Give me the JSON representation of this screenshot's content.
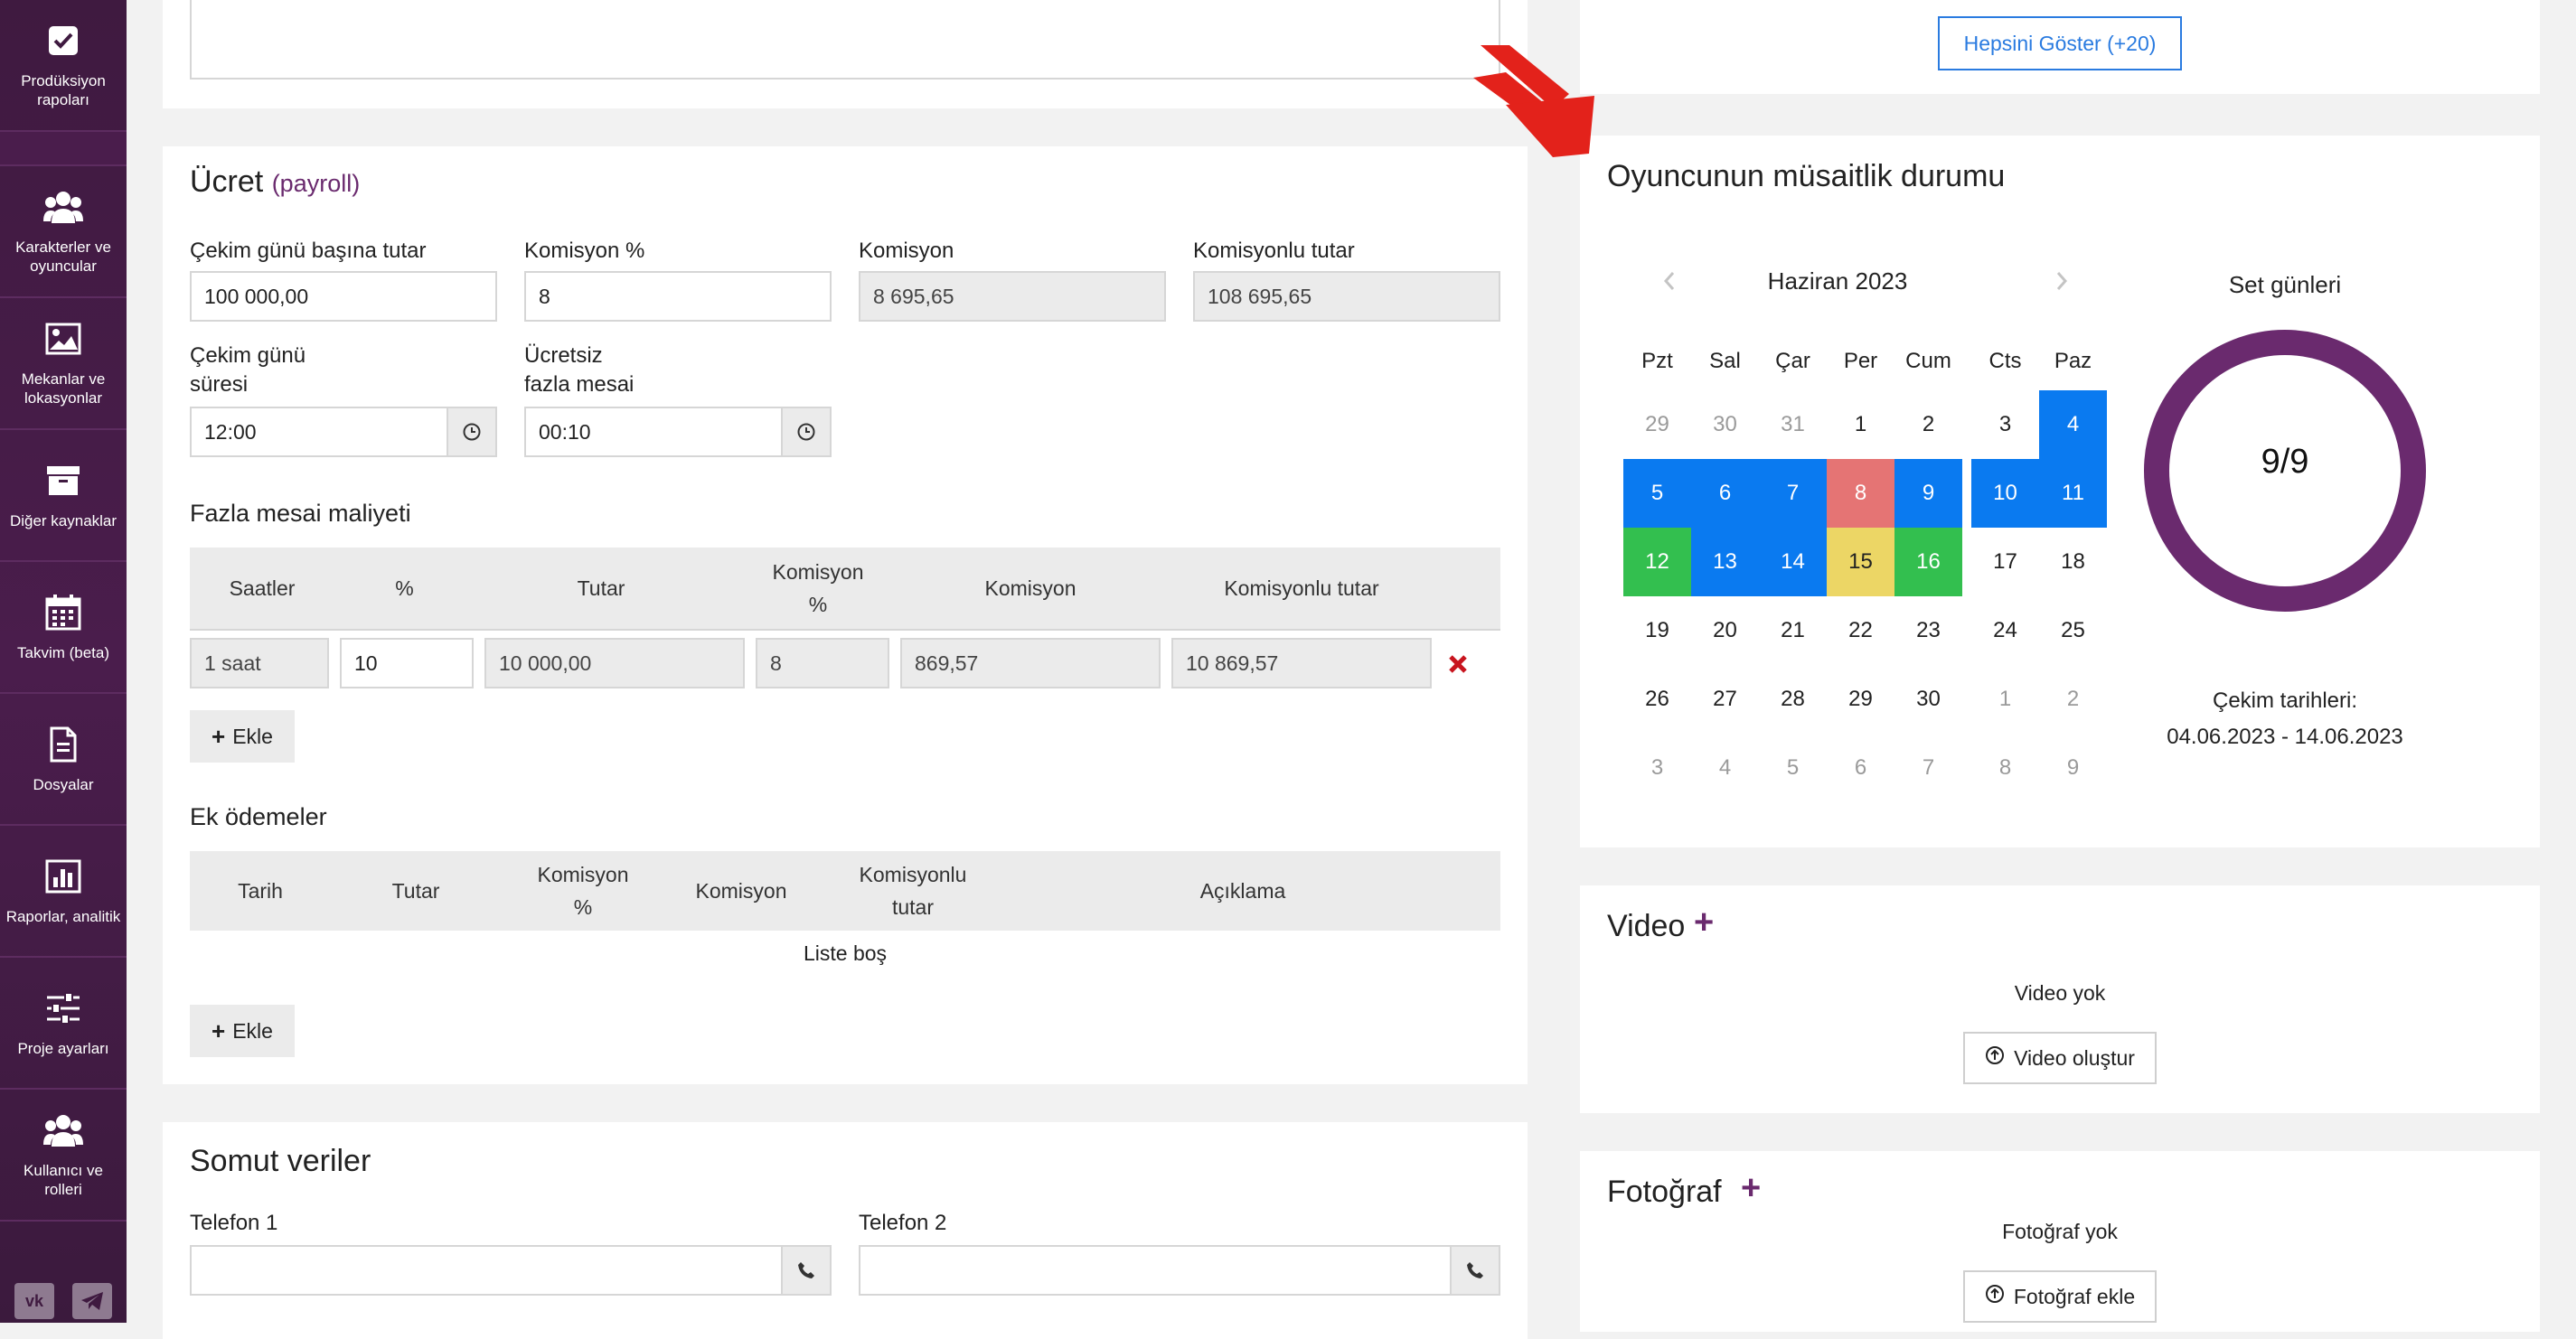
{
  "sidebar": {
    "items": [
      {
        "label": "Prodüksiyon rapoları",
        "icon": "checkbox-icon"
      },
      {
        "label": "Karakterler ve oyuncular",
        "icon": "users-icon"
      },
      {
        "label": "Mekanlar ve lokasyonlar",
        "icon": "image-icon"
      },
      {
        "label": "Diğer kaynaklar",
        "icon": "archive-icon"
      },
      {
        "label": "Takvim (beta)",
        "icon": "calendar-icon"
      },
      {
        "label": "Dosyalar",
        "icon": "file-icon"
      },
      {
        "label": "Raporlar, analitik",
        "icon": "bar-chart-icon"
      },
      {
        "label": "Proje ayarları",
        "icon": "sliders-icon"
      },
      {
        "label": "Kullanıcı ve rolleri",
        "icon": "users-icon"
      }
    ],
    "social": [
      "vk-icon",
      "telegram-icon"
    ]
  },
  "payroll": {
    "title": "Ücret",
    "subtitle": "(payroll)",
    "fields": {
      "per_day_label": "Çekim günü başına tutar",
      "per_day_value": "100 000,00",
      "commission_pct_label": "Komisyon %",
      "commission_pct_value": "8",
      "commission_label": "Komisyon",
      "commission_value": "8 695,65",
      "with_commission_label": "Komisyonlu tutar",
      "with_commission_value": "108 695,65",
      "duration_label_1": "Çekim günü",
      "duration_label_2": "süresi",
      "duration_value": "12:00",
      "free_overtime_label_1": "Ücretsiz",
      "free_overtime_label_2": "fazla mesai",
      "free_overtime_value": "00:10"
    },
    "overtime": {
      "title": "Fazla mesai maliyeti",
      "headers": [
        "Saatler",
        "%",
        "Tutar",
        "Komisyon %",
        "Komisyon",
        "Komisyonlu tutar"
      ],
      "header_komisyon_1": "Komisyon",
      "header_komisyon_2": "%",
      "row": {
        "hours": "1 saat",
        "pct": "10",
        "amount": "10 000,00",
        "comm_pct": "8",
        "comm": "869,57",
        "total": "10 869,57"
      },
      "add_label": "Ekle"
    },
    "extra": {
      "title": "Ek ödemeler",
      "headers": [
        "Tarih",
        "Tutar",
        "Komisyon %",
        "Komisyon",
        "Komisyonlu tutar",
        "Açıklama"
      ],
      "h_kp_1": "Komisyon",
      "h_kp_2": "%",
      "h_kt_1": "Komisyonlu",
      "h_kt_2": "tutar",
      "empty": "Liste boş",
      "add_label": "Ekle"
    }
  },
  "concrete": {
    "title": "Somut veriler",
    "phone1_label": "Telefon 1",
    "phone2_label": "Telefon 2"
  },
  "right": {
    "show_all": "Hepsini Göster (+20)",
    "availability_title": "Oyuncunun müsaitlik durumu",
    "calendar": {
      "month": "Haziran 2023",
      "dow": [
        "Pzt",
        "Sal",
        "Çar",
        "Per",
        "Cum",
        "Cts",
        "Paz"
      ],
      "weeks": [
        [
          {
            "d": "29",
            "s": "muted"
          },
          {
            "d": "30",
            "s": "muted"
          },
          {
            "d": "31",
            "s": "muted"
          },
          {
            "d": "1",
            "s": ""
          },
          {
            "d": "2",
            "s": ""
          },
          {
            "d": "3",
            "s": ""
          },
          {
            "d": "4",
            "s": "blue"
          }
        ],
        [
          {
            "d": "5",
            "s": "blue"
          },
          {
            "d": "6",
            "s": "blue"
          },
          {
            "d": "7",
            "s": "blue"
          },
          {
            "d": "8",
            "s": "red"
          },
          {
            "d": "9",
            "s": "blue"
          },
          {
            "d": "10",
            "s": "blue"
          },
          {
            "d": "11",
            "s": "blue"
          }
        ],
        [
          {
            "d": "12",
            "s": "green"
          },
          {
            "d": "13",
            "s": "blue"
          },
          {
            "d": "14",
            "s": "blue"
          },
          {
            "d": "15",
            "s": "yellow"
          },
          {
            "d": "16",
            "s": "green"
          },
          {
            "d": "17",
            "s": ""
          },
          {
            "d": "18",
            "s": ""
          }
        ],
        [
          {
            "d": "19",
            "s": ""
          },
          {
            "d": "20",
            "s": ""
          },
          {
            "d": "21",
            "s": ""
          },
          {
            "d": "22",
            "s": ""
          },
          {
            "d": "23",
            "s": ""
          },
          {
            "d": "24",
            "s": ""
          },
          {
            "d": "25",
            "s": ""
          }
        ],
        [
          {
            "d": "26",
            "s": ""
          },
          {
            "d": "27",
            "s": ""
          },
          {
            "d": "28",
            "s": ""
          },
          {
            "d": "29",
            "s": ""
          },
          {
            "d": "30",
            "s": ""
          },
          {
            "d": "1",
            "s": "muted"
          },
          {
            "d": "2",
            "s": "muted"
          }
        ],
        [
          {
            "d": "3",
            "s": "muted"
          },
          {
            "d": "4",
            "s": "muted"
          },
          {
            "d": "5",
            "s": "muted"
          },
          {
            "d": "6",
            "s": "muted"
          },
          {
            "d": "7",
            "s": "muted"
          },
          {
            "d": "8",
            "s": "muted"
          },
          {
            "d": "9",
            "s": "muted"
          }
        ]
      ]
    },
    "set_days_title": "Set günleri",
    "set_days_value": "9/9",
    "shoot_dates_label": "Çekim tarihleri:",
    "shoot_dates_value": "04.06.2023 - 14.06.2023",
    "video_title": "Video",
    "video_empty": "Video yok",
    "video_button": "Video oluştur",
    "photo_title": "Fotoğraf",
    "photo_empty": "Fotoğraf yok",
    "photo_button": "Fotoğraf ekle"
  },
  "colors": {
    "sidebar": "#3f1a40",
    "accent": "#6a2a6e",
    "calendar_blue": "#0a7af0",
    "calendar_red": "#e57474",
    "calendar_yellow": "#ecd665",
    "calendar_green": "#33bf4f",
    "arrow": "#e3221b",
    "link_blue": "#2a7be0"
  }
}
